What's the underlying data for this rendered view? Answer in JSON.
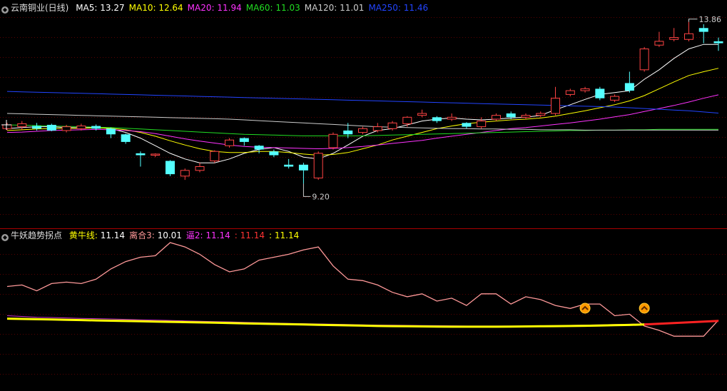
{
  "chart_data": [
    {
      "type": "candlestick",
      "title": "云南铜业(日线)",
      "ylim": [
        8.8,
        14.1
      ],
      "ma_legend": [
        {
          "label": "MA5",
          "value": "13.27",
          "color": "#ffffff"
        },
        {
          "label": "MA10",
          "value": "12.64",
          "color": "#ffff00"
        },
        {
          "label": "MA20",
          "value": "11.94",
          "color": "#ff33ff"
        },
        {
          "label": "MA60",
          "value": "11.03",
          "color": "#22dd22"
        },
        {
          "label": "MA120",
          "value": "11.01",
          "color": "#cccccc"
        },
        {
          "label": "MA250",
          "value": "11.46",
          "color": "#2244ff"
        }
      ],
      "annotations": {
        "high": "13.86",
        "low": "9.20"
      },
      "candles": [
        [
          11.05,
          11.15,
          11.0,
          11.2
        ],
        [
          11.1,
          11.18,
          11.02,
          11.25
        ],
        [
          11.12,
          11.05,
          11.0,
          11.2
        ],
        [
          11.15,
          11.0,
          10.98,
          11.18
        ],
        [
          11.0,
          11.1,
          10.95,
          11.15
        ],
        [
          11.05,
          11.12,
          11.0,
          11.18
        ],
        [
          11.12,
          11.05,
          11.0,
          11.16
        ],
        [
          11.05,
          10.9,
          10.8,
          11.08
        ],
        [
          10.9,
          10.7,
          10.65,
          10.92
        ],
        [
          10.4,
          10.35,
          10.05,
          10.45
        ],
        [
          10.35,
          10.38,
          10.3,
          10.4
        ],
        [
          10.2,
          9.85,
          9.8,
          10.22
        ],
        [
          9.8,
          9.95,
          9.7,
          10.0
        ],
        [
          9.95,
          10.05,
          9.9,
          10.15
        ],
        [
          10.2,
          10.45,
          10.15,
          10.48
        ],
        [
          10.6,
          10.75,
          10.55,
          10.8
        ],
        [
          10.8,
          10.7,
          10.6,
          10.82
        ],
        [
          10.6,
          10.5,
          10.4,
          10.62
        ],
        [
          10.45,
          10.35,
          10.3,
          10.5
        ],
        [
          10.1,
          10.05,
          10.0,
          10.25
        ],
        [
          10.1,
          9.95,
          9.6,
          10.15
        ],
        [
          9.75,
          10.4,
          9.7,
          10.45
        ],
        [
          10.55,
          10.9,
          10.5,
          10.95
        ],
        [
          11.0,
          10.9,
          10.8,
          11.2
        ],
        [
          10.95,
          11.05,
          10.9,
          11.1
        ],
        [
          11.0,
          11.1,
          10.95,
          11.2
        ],
        [
          11.05,
          11.2,
          11.0,
          11.25
        ],
        [
          11.18,
          11.35,
          11.1,
          11.38
        ],
        [
          11.4,
          11.45,
          11.35,
          11.55
        ],
        [
          11.35,
          11.25,
          11.2,
          11.38
        ],
        [
          11.3,
          11.35,
          11.25,
          11.45
        ],
        [
          11.2,
          11.1,
          11.05,
          11.22
        ],
        [
          11.1,
          11.25,
          11.05,
          11.35
        ],
        [
          11.3,
          11.4,
          11.25,
          11.45
        ],
        [
          11.45,
          11.35,
          11.3,
          11.5
        ],
        [
          11.35,
          11.4,
          11.3,
          11.45
        ],
        [
          11.4,
          11.45,
          11.35,
          11.5
        ],
        [
          11.45,
          11.85,
          11.4,
          12.15
        ],
        [
          11.95,
          12.05,
          11.9,
          12.1
        ],
        [
          12.05,
          12.1,
          12.0,
          12.15
        ],
        [
          12.1,
          11.85,
          11.8,
          12.15
        ],
        [
          11.8,
          11.9,
          11.75,
          11.95
        ],
        [
          12.25,
          12.05,
          12.0,
          12.55
        ],
        [
          12.6,
          13.15,
          12.55,
          13.2
        ],
        [
          13.25,
          13.35,
          13.2,
          13.6
        ],
        [
          13.4,
          13.45,
          13.35,
          13.7
        ],
        [
          13.4,
          13.55,
          13.35,
          13.86
        ],
        [
          13.7,
          13.6,
          13.3,
          13.8
        ],
        [
          13.35,
          13.3,
          13.1,
          13.45
        ]
      ],
      "ma": {
        "MA5": [
          11.05,
          11.08,
          11.1,
          11.1,
          11.08,
          11.07,
          11.08,
          11.05,
          10.95,
          10.8,
          10.6,
          10.4,
          10.25,
          10.15,
          10.15,
          10.25,
          10.4,
          10.5,
          10.55,
          10.45,
          10.3,
          10.25,
          10.4,
          10.62,
          10.85,
          11.0,
          11.05,
          11.15,
          11.25,
          11.3,
          11.33,
          11.3,
          11.28,
          11.3,
          11.33,
          11.35,
          11.4,
          11.55,
          11.68,
          11.82,
          11.95,
          12.0,
          12.05,
          12.35,
          12.6,
          12.9,
          13.15,
          13.27,
          13.27
        ],
        "MA10": [
          11.0,
          11.02,
          11.04,
          11.05,
          11.06,
          11.06,
          11.07,
          11.06,
          11.02,
          10.95,
          10.85,
          10.73,
          10.62,
          10.52,
          10.45,
          10.42,
          10.42,
          10.45,
          10.45,
          10.42,
          10.38,
          10.35,
          10.37,
          10.42,
          10.52,
          10.62,
          10.75,
          10.85,
          10.95,
          11.05,
          11.12,
          11.18,
          11.22,
          11.25,
          11.28,
          11.3,
          11.33,
          11.38,
          11.45,
          11.52,
          11.6,
          11.68,
          11.78,
          11.92,
          12.1,
          12.28,
          12.45,
          12.55,
          12.64
        ],
        "MA20": [
          10.95,
          10.96,
          10.98,
          11.0,
          11.01,
          11.02,
          11.03,
          11.02,
          11.0,
          10.97,
          10.92,
          10.85,
          10.78,
          10.72,
          10.67,
          10.62,
          10.58,
          10.56,
          10.55,
          10.54,
          10.53,
          10.52,
          10.53,
          10.55,
          10.58,
          10.62,
          10.66,
          10.7,
          10.74,
          10.8,
          10.85,
          10.9,
          10.95,
          11.0,
          11.05,
          11.08,
          11.12,
          11.16,
          11.2,
          11.25,
          11.3,
          11.36,
          11.42,
          11.5,
          11.58,
          11.66,
          11.75,
          11.85,
          11.94
        ],
        "MA60": [
          11.15,
          11.14,
          11.13,
          11.12,
          11.11,
          11.1,
          11.09,
          11.08,
          11.06,
          11.04,
          11.02,
          11.0,
          10.98,
          10.96,
          10.94,
          10.92,
          10.9,
          10.89,
          10.88,
          10.87,
          10.86,
          10.86,
          10.86,
          10.86,
          10.86,
          10.87,
          10.88,
          10.89,
          10.9,
          10.91,
          10.92,
          10.93,
          10.94,
          10.95,
          10.96,
          10.97,
          10.98,
          10.99,
          11.0,
          11.0,
          11.01,
          11.01,
          11.02,
          11.02,
          11.03,
          11.03,
          11.03,
          11.03,
          11.03
        ],
        "MA120": [
          11.45,
          11.44,
          11.43,
          11.42,
          11.41,
          11.4,
          11.39,
          11.38,
          11.37,
          11.36,
          11.35,
          11.34,
          11.33,
          11.32,
          11.31,
          11.3,
          11.28,
          11.26,
          11.24,
          11.22,
          11.2,
          11.18,
          11.16,
          11.14,
          11.12,
          11.1,
          11.09,
          11.08,
          11.07,
          11.06,
          11.05,
          11.05,
          11.04,
          11.04,
          11.03,
          11.03,
          11.02,
          11.02,
          11.02,
          11.01,
          11.01,
          11.01,
          11.01,
          11.01,
          11.01,
          11.01,
          11.01,
          11.01,
          11.01
        ],
        "MA250": [
          12.03,
          12.02,
          12.01,
          12.0,
          11.99,
          11.98,
          11.97,
          11.96,
          11.95,
          11.94,
          11.93,
          11.92,
          11.91,
          11.9,
          11.89,
          11.88,
          11.87,
          11.86,
          11.85,
          11.84,
          11.83,
          11.82,
          11.81,
          11.8,
          11.79,
          11.78,
          11.77,
          11.76,
          11.75,
          11.74,
          11.73,
          11.72,
          11.71,
          11.7,
          11.69,
          11.68,
          11.67,
          11.66,
          11.65,
          11.64,
          11.63,
          11.62,
          11.6,
          11.58,
          11.56,
          11.54,
          11.52,
          11.49,
          11.46
        ]
      }
    },
    {
      "type": "line",
      "title": "牛妖趋势拐点",
      "ylim": [
        0,
        100
      ],
      "legend": [
        {
          "label": "黄牛线",
          "value": "11.14",
          "label_color": "#ffff00",
          "value_color": "#ffffff"
        },
        {
          "label": "离合3",
          "value": "10.01",
          "label_color": "#ff9999",
          "value_color": "#ffffff"
        },
        {
          "label": "逼2",
          "value": "11.14",
          "label_color": "#ff33ff",
          "value_color": "#ff33ff"
        },
        {
          "label": "",
          "value": "11.14",
          "label_color": "#ff3333",
          "value_color": "#ff3333"
        },
        {
          "label": "",
          "value": "11.14",
          "label_color": "#ffff00",
          "value_color": "#ffff00"
        }
      ],
      "pink_line": [
        70,
        71,
        67,
        72,
        73,
        72,
        75,
        82,
        87,
        90,
        91,
        100,
        97,
        92,
        85,
        80,
        82,
        88,
        90,
        92,
        95,
        97,
        84,
        75,
        74,
        71,
        66,
        63,
        65,
        60,
        62,
        57,
        65,
        65,
        58,
        63,
        61,
        57,
        55,
        58,
        58,
        50,
        51,
        43,
        40,
        36,
        36,
        36,
        47
      ],
      "magenta_line": [
        50,
        49.5,
        49,
        48.8,
        48.5,
        48.2,
        48,
        47.8,
        47.5,
        47.2,
        47,
        46.8,
        46.5,
        46.2,
        46,
        45.8,
        45.5,
        45.2,
        45,
        44.8,
        44.6,
        44.4,
        44.2,
        44,
        43.8,
        43.6,
        43.5,
        43.4,
        43.3,
        43.2,
        43.1,
        43,
        43,
        43,
        43,
        43,
        43.1,
        43.2,
        43.4,
        43.6,
        43.8,
        44,
        44.2,
        44.5,
        44.8,
        45.2,
        45.6,
        46,
        46.5
      ],
      "yellow_line": [
        48,
        47.8,
        47.6,
        47.4,
        47.2,
        47,
        46.8,
        46.6,
        46.4,
        46.2,
        46,
        45.8,
        45.6,
        45.4,
        45.2,
        45,
        44.8,
        44.6,
        44.4,
        44.2,
        44,
        43.8,
        43.6,
        43.4,
        43.2,
        43,
        42.9,
        42.8,
        42.7,
        42.6,
        42.5,
        42.5,
        42.5,
        42.5,
        42.6,
        42.7,
        42.8,
        42.9,
        43,
        43.1,
        43.3,
        43.5,
        43.7,
        44,
        44.5,
        45,
        45.5,
        46,
        46.5
      ],
      "red_from_index": 43,
      "signal_indices": [
        39,
        43
      ]
    }
  ]
}
